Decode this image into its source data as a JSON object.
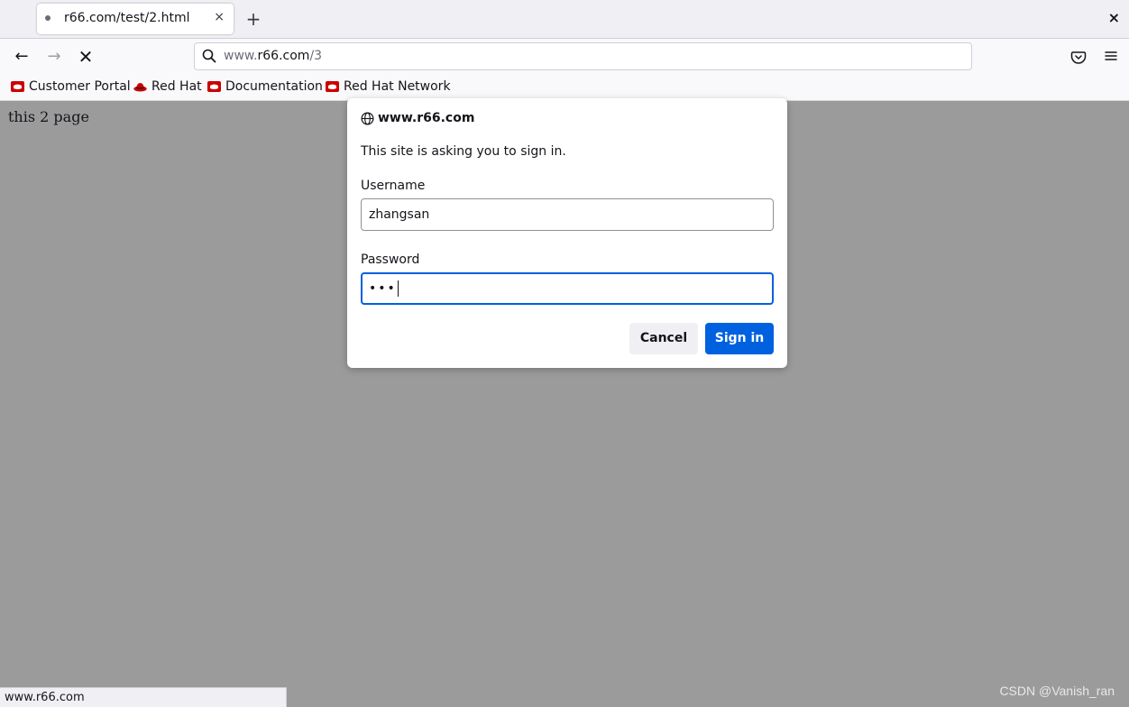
{
  "tab": {
    "title": "r66.com/test/2.html",
    "close": "×"
  },
  "new_tab": "+",
  "window_close": "×",
  "nav": {
    "back": "←",
    "forward": "→",
    "stop": "✕"
  },
  "urlbar": {
    "prefix": "www.",
    "host": "r66.com",
    "path": "/3"
  },
  "bookmarks": [
    {
      "label": "Customer Portal",
      "icon": "redhat-bookmark-icon"
    },
    {
      "label": "Red Hat",
      "icon": "redhat-fedora-icon"
    },
    {
      "label": "Documentation",
      "icon": "redhat-bookmark-icon"
    },
    {
      "label": "Red Hat Network",
      "icon": "redhat-bookmark-icon"
    }
  ],
  "page": {
    "text": "this 2 page"
  },
  "dialog": {
    "host": "www.r66.com",
    "message": "This site is asking you to sign in.",
    "username_label": "Username",
    "username_value": "zhangsan",
    "password_label": "Password",
    "password_dots": "•••",
    "cancel_label": "Cancel",
    "signin_label": "Sign in"
  },
  "status": {
    "text": "www.r66.com"
  },
  "watermark": "CSDN @Vanish_ran",
  "colors": {
    "accent": "#0061e0",
    "overlay": "#9b9b9c",
    "redhat": "#cc0000"
  }
}
